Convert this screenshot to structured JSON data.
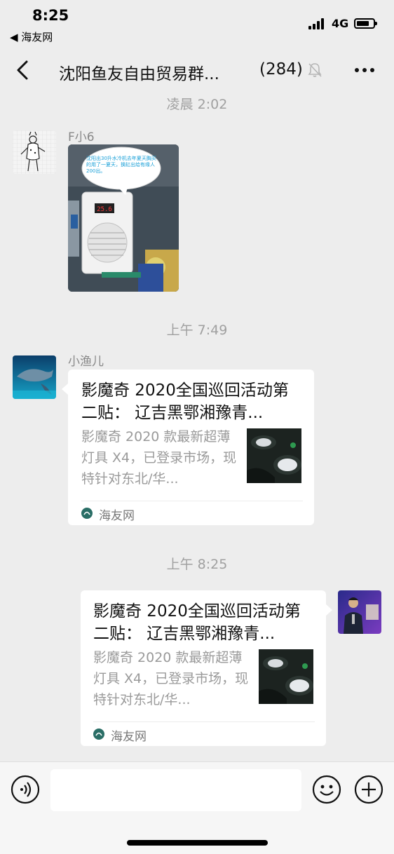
{
  "status_bar": {
    "time": "8:25",
    "back_app": "◀ 海友网",
    "network": "4G"
  },
  "header": {
    "title": "沈阳鱼友自由贸易群...",
    "member_count": "(284)",
    "icons": [
      "back-arrow-icon",
      "mute-bell-icon",
      "more-icon"
    ]
  },
  "chat": {
    "timestamps": [
      "凌晨 2:02",
      "上午 7:49",
      "上午 8:25"
    ],
    "messages": [
      {
        "sender": "F小6",
        "type": "image",
        "bubble_text": "沈阳出30升水冷机去年夏天胸买的用了一夏天，换缸出给有缘人 200出。",
        "display_reading": "25.6"
      },
      {
        "sender": "小渔儿",
        "type": "link-card",
        "title": "影魔奇 2020全国巡回活动第二贴： 辽吉黑鄂湘豫青...",
        "description": "影魔奇 2020 款最新超薄灯具 X4，已登录市场，现特针对东北/华...",
        "source": "海友网"
      },
      {
        "sender": "me",
        "type": "link-card",
        "title": "影魔奇 2020全国巡回活动第二贴： 辽吉黑鄂湘豫青...",
        "description": "影魔奇 2020 款最新超薄灯具 X4，已登录市场，现特针对东北/华...",
        "source": "海友网"
      }
    ]
  },
  "input_bar": {
    "icons": [
      "voice-icon",
      "emoji-icon",
      "plus-icon"
    ],
    "placeholder": ""
  },
  "colors": {
    "background": "#ededed",
    "bubble": "#ffffff",
    "timestamp": "#a0a0a0",
    "source_icon": "#2a6e66"
  }
}
